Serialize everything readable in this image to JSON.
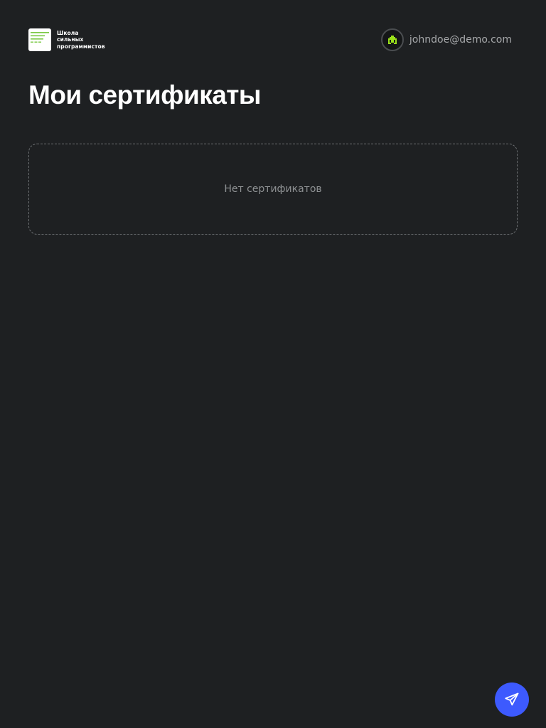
{
  "header": {
    "logo": {
      "lines": [
        "Школа",
        "сильных",
        "программистов"
      ],
      "accent_color": "#7ac943"
    },
    "user": {
      "email": "johndoe@demo.com",
      "avatar_icon": "green-pixel-house-icon",
      "avatar_color": "#9be21b"
    }
  },
  "main": {
    "title": "Мои сертификаты",
    "empty_message": "Нет сертификатов"
  },
  "floating_button": {
    "icon": "paper-plane-icon",
    "color": "#3d5afe"
  }
}
